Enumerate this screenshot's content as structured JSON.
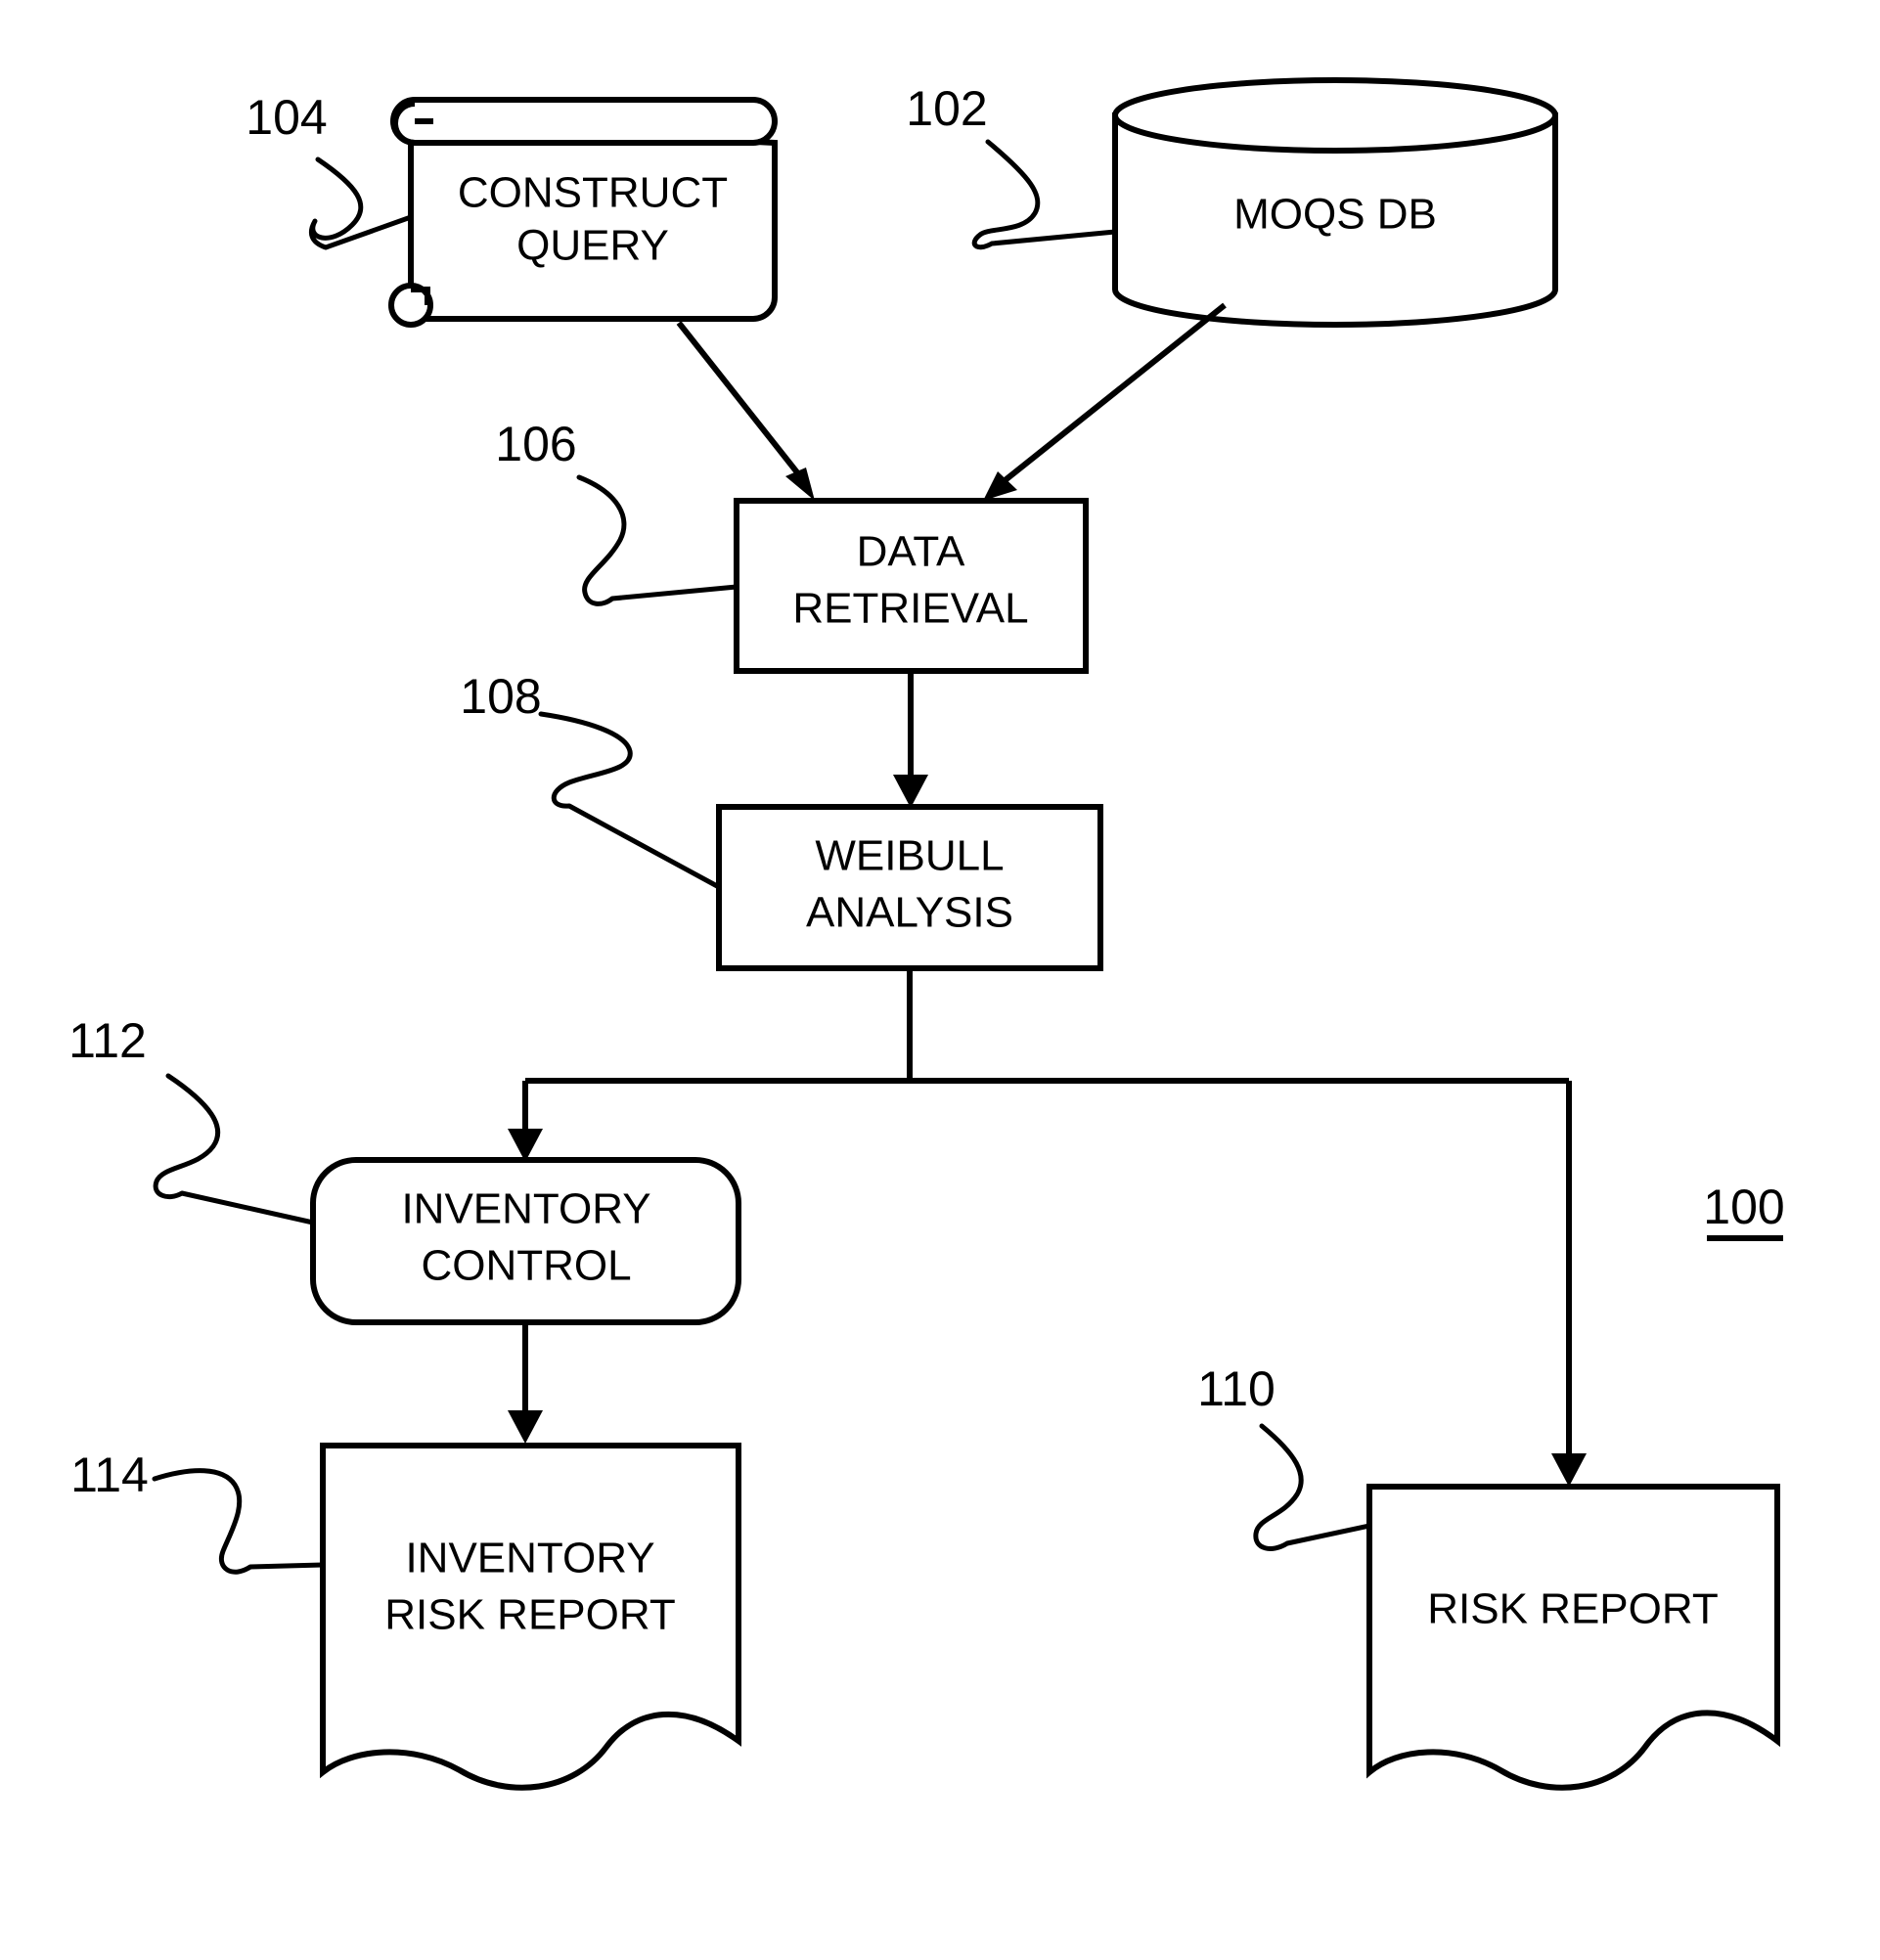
{
  "figure": {
    "overall_ref": "100",
    "nodes": [
      {
        "id": "moqs-db",
        "ref": "102",
        "label_line1": "MOQS DB",
        "label_line2": "",
        "shape": "cylinder"
      },
      {
        "id": "construct-query",
        "ref": "104",
        "label_line1": "CONSTRUCT",
        "label_line2": "QUERY",
        "shape": "scroll"
      },
      {
        "id": "data-retrieval",
        "ref": "106",
        "label_line1": "DATA",
        "label_line2": "RETRIEVAL",
        "shape": "rectangle"
      },
      {
        "id": "weibull-analysis",
        "ref": "108",
        "label_line1": "WEIBULL",
        "label_line2": "ANALYSIS",
        "shape": "rectangle"
      },
      {
        "id": "risk-report",
        "ref": "110",
        "label_line1": "RISK REPORT",
        "label_line2": "",
        "shape": "document"
      },
      {
        "id": "inventory-control",
        "ref": "112",
        "label_line1": "INVENTORY",
        "label_line2": "CONTROL",
        "shape": "rounded-rectangle"
      },
      {
        "id": "inventory-risk-report",
        "ref": "114",
        "label_line1": "INVENTORY",
        "label_line2": "RISK REPORT",
        "shape": "document"
      }
    ],
    "colors": {
      "stroke": "#000000",
      "background": "#ffffff"
    }
  }
}
